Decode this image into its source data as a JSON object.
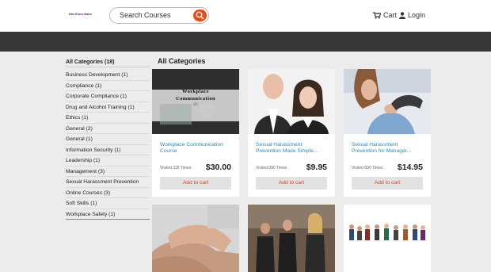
{
  "header": {
    "logo_text": "Milo Evans Maine (MTM)",
    "search_placeholder": "Search Courses",
    "cart_label": "Cart",
    "login_label": "Login"
  },
  "sidebar": {
    "all_label": "All Categories (18)",
    "items": [
      "Business Development (1)",
      "Compliance (1)",
      "Corporate Compliance (1)",
      "Drug and Alcohol Training (1)",
      "Ethics (1)",
      "General (2)",
      "General (1)",
      "Information Security (1)",
      "Leadership (1)",
      "Management (3)",
      "Sexual Harassment Prevention",
      "Online Courses (3)",
      "Soft Skills (1)",
      "Workplace Safety (1)"
    ]
  },
  "main": {
    "title": "All Categories",
    "courses": [
      {
        "title": "Workplace Communication Course",
        "visited": "Visited 328 Times",
        "price": "$30.00",
        "button": "Add to cart",
        "image_text": "Workplace Communication"
      },
      {
        "title": "Sexual Harassment Prevention Made Simple...",
        "visited": "Visited 990 Times",
        "price": "$9.95",
        "button": "Add to cart"
      },
      {
        "title": "Sexual Harassment Prevention for Manager...",
        "visited": "Visited 600 Times",
        "price": "$14.95",
        "button": "Add to cart"
      }
    ]
  },
  "colors": {
    "accent": "#f04a13",
    "link": "#1a8fd6",
    "band": "#363636"
  }
}
